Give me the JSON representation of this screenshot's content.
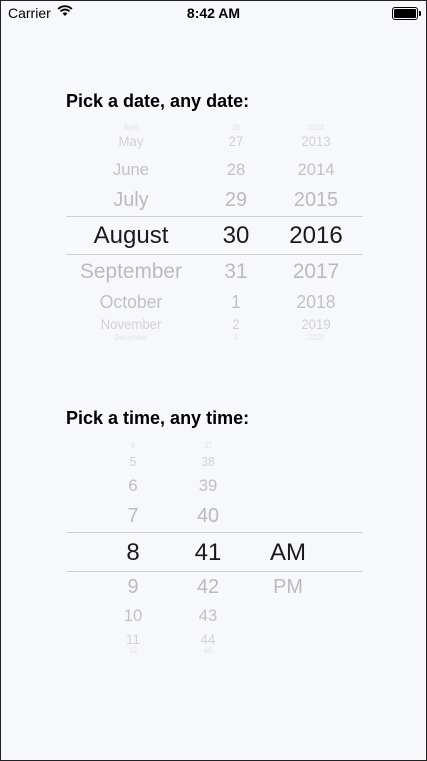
{
  "status_bar": {
    "carrier": "Carrier",
    "time": "8:42 AM",
    "icons": [
      "wifi-icon",
      "battery-icon"
    ]
  },
  "date_picker": {
    "heading": "Pick a date, any date:",
    "months": [
      "April",
      "May",
      "June",
      "July",
      "August",
      "September",
      "October",
      "November",
      "December"
    ],
    "days": [
      "26",
      "27",
      "28",
      "29",
      "30",
      "31",
      "1",
      "2",
      "3"
    ],
    "years": [
      "2012",
      "2013",
      "2014",
      "2015",
      "2016",
      "2017",
      "2018",
      "2019",
      "2020"
    ],
    "selected": {
      "month": "August",
      "day": "30",
      "year": "2016"
    }
  },
  "time_picker": {
    "heading": "Pick a time, any time:",
    "hours": [
      "4",
      "5",
      "6",
      "7",
      "8",
      "9",
      "10",
      "11",
      "12"
    ],
    "minutes": [
      "37",
      "38",
      "39",
      "40",
      "41",
      "42",
      "43",
      "44",
      "45"
    ],
    "periods": [
      "AM",
      "PM"
    ],
    "selected": {
      "hour": "8",
      "minute": "41",
      "period": "AM"
    }
  },
  "colors": {
    "background": "#f7f8fc",
    "selected_text": "#1a1a1a",
    "unselected_text": "#b8b8bc",
    "selection_line": "#d0d0d4"
  }
}
